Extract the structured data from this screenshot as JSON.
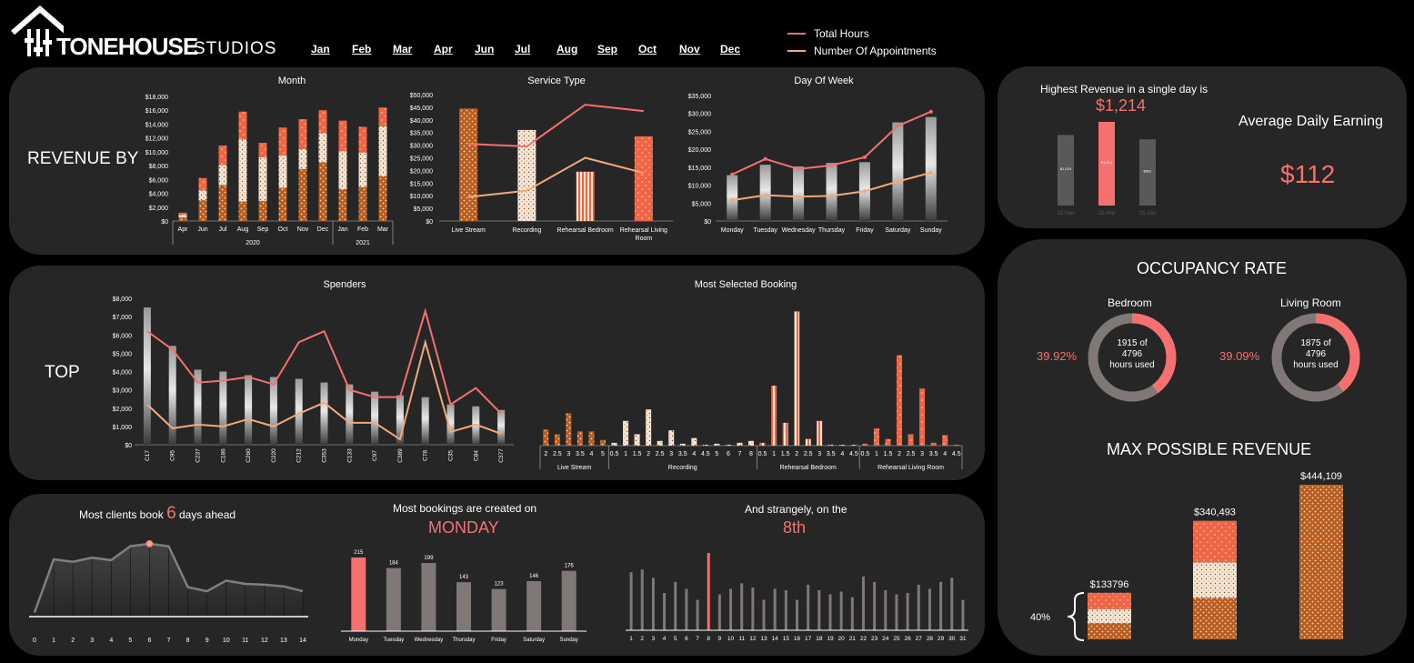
{
  "brand": {
    "name": "TONEHOUSE",
    "suffix": "STUDIOS"
  },
  "months_nav": [
    "Jan",
    "Feb",
    "Mar",
    "Apr",
    "Jun",
    "Jul",
    "Aug",
    "Sep",
    "Oct",
    "Nov",
    "Dec"
  ],
  "legend": {
    "total_hours": "Total Hours",
    "appointments": "Number Of Appointments"
  },
  "colors": {
    "background": "#000000",
    "panel": "#262626",
    "accent": "#f4716f",
    "peach": "#f2a97e",
    "brown": "#b85d1f",
    "orange": "#f06543"
  },
  "revenue": {
    "heading": "REVENUE BY"
  },
  "top": {
    "heading": "TOP"
  },
  "highest": {
    "label": "Highest Revenue in a single day is",
    "value": "$1,214",
    "bars": [
      {
        "date": "11-Mar",
        "label": "$1,024",
        "value": 1024
      },
      {
        "date": "15-Mar",
        "label": "$1,214",
        "value": 1214
      },
      {
        "date": "31-Jan",
        "label": "$961",
        "value": 961
      }
    ]
  },
  "average": {
    "label": "Average Daily Earning",
    "value": "$112"
  },
  "occupancy": {
    "title": "OCCUPANCY RATE",
    "bedroom": {
      "label": "Bedroom",
      "pct": "39.92%",
      "text1": "1915 of",
      "text2": "4796",
      "text3": "hours used",
      "fraction": 0.3992
    },
    "living": {
      "label": "Living Room",
      "pct": "39.09%",
      "text1": "1875 of",
      "text2": "4796",
      "text3": "hours used",
      "fraction": 0.3909
    }
  },
  "max_revenue": {
    "title": "MAX POSSIBLE REVENUE",
    "bars": [
      {
        "label": "$133796",
        "value": 133796
      },
      {
        "label": "$340,493",
        "value": 340493
      },
      {
        "label": "$444,109",
        "value": 444109
      }
    ],
    "pct_label": "40%"
  },
  "clients": {
    "pre": "Most clients book",
    "num": "6",
    "post": "days ahead"
  },
  "bookings_created": {
    "label": "Most bookings are created on",
    "value": "MONDAY"
  },
  "strangely": {
    "label": "And strangely, on the",
    "value": "8th"
  },
  "chart_data": [
    {
      "id": "month",
      "type": "bar",
      "title": "Month",
      "stacked": true,
      "ytick_labels": [
        "$18,000",
        "$16,000",
        "$14,000",
        "$12,000",
        "$10,000",
        "$8,000",
        "$6,000",
        "$4,000",
        "$2,000",
        "$0"
      ],
      "ylim": [
        0,
        18000
      ],
      "categories": [
        "Apr",
        "Jun",
        "Jul",
        "Aug",
        "Sep",
        "Oct",
        "Nov",
        "Dec",
        "Jan",
        "Feb",
        "Mar"
      ],
      "groups": [
        {
          "label": "2020",
          "span": 8
        },
        {
          "label": "2021",
          "span": 3
        }
      ],
      "series": [
        {
          "values": [
            500,
            3000,
            5200,
            2800,
            2900,
            4800,
            7500,
            8500,
            4600,
            4900,
            6500
          ]
        },
        {
          "values": [
            400,
            1400,
            2900,
            9000,
            6300,
            4700,
            2900,
            4200,
            5500,
            5000,
            7200
          ]
        },
        {
          "values": [
            300,
            1800,
            2800,
            4000,
            2100,
            4000,
            4300,
            3300,
            4400,
            3700,
            2700
          ]
        }
      ]
    },
    {
      "id": "service",
      "type": "bar",
      "title": "Service Type",
      "ytick_labels": [
        "$50,000",
        "$45,000",
        "$40,000",
        "$35,000",
        "$30,000",
        "$25,000",
        "$20,000",
        "$15,000",
        "$10,000",
        "$5,000",
        "$0"
      ],
      "ylim": [
        0,
        50000
      ],
      "categories": [
        "Live Stream",
        "Recording",
        "Rehearsal Bedroom",
        "Rehearsal Living Room"
      ],
      "values": [
        44500,
        36000,
        19500,
        33500
      ],
      "lines": [
        {
          "values": [
            30500,
            29500,
            46000,
            43500
          ]
        },
        {
          "values": [
            9500,
            12000,
            25000,
            19000
          ]
        }
      ]
    },
    {
      "id": "dow",
      "type": "bar",
      "title": "Day Of Week",
      "ytick_labels": [
        "$35,000",
        "$30,000",
        "$25,000",
        "$20,000",
        "$15,000",
        "$10,000",
        "$5,000",
        "$0"
      ],
      "ylim": [
        0,
        35000
      ],
      "categories": [
        "Monday",
        "Tuesday",
        "Wednesday",
        "Thursday",
        "Friday",
        "Saturday",
        "Sunday"
      ],
      "values": [
        12800,
        15700,
        15200,
        16200,
        16400,
        27500,
        29000
      ],
      "lines": [
        {
          "values": [
            13000,
            17300,
            14500,
            15500,
            17800,
            26500,
            30500
          ]
        },
        {
          "values": [
            5800,
            7200,
            6800,
            7000,
            8300,
            11000,
            13500
          ]
        }
      ]
    },
    {
      "id": "spenders",
      "type": "bar",
      "title": "Spenders",
      "ytick_labels": [
        "$8,000",
        "$7,000",
        "$6,000",
        "$5,000",
        "$4,000",
        "$3,000",
        "$2,000",
        "$1,000",
        "$0"
      ],
      "ylim": [
        0,
        8000
      ],
      "categories": [
        "C17",
        "C95",
        "C237",
        "C186",
        "C260",
        "C220",
        "C212",
        "C353",
        "C133",
        "C97",
        "C389",
        "C78",
        "C35",
        "C84",
        "C377"
      ],
      "values": [
        7500,
        5400,
        4100,
        4000,
        3800,
        3700,
        3600,
        3400,
        3300,
        2900,
        2700,
        2600,
        2200,
        2100,
        1900
      ],
      "lines": [
        {
          "values": [
            6200,
            5200,
            3400,
            3500,
            3700,
            3300,
            5600,
            6200,
            3000,
            2600,
            2600,
            7300,
            2200,
            3100,
            1700
          ]
        },
        {
          "values": [
            2200,
            900,
            1100,
            1000,
            1400,
            1000,
            1700,
            2300,
            1200,
            1200,
            300,
            5600,
            700,
            1100,
            600
          ]
        }
      ]
    },
    {
      "id": "booking",
      "type": "bar",
      "title": "Most Selected Booking",
      "groups": [
        {
          "label": "Live Stream",
          "cats": [
            "2",
            "2.5",
            "3",
            "3.5",
            "4",
            "5"
          ],
          "values": [
            17,
            12,
            34,
            15,
            15,
            6
          ]
        },
        {
          "label": "Recording",
          "cats": [
            "0.5",
            "1",
            "1.5",
            "2",
            "2.5",
            "3",
            "3.5",
            "4",
            "4.5",
            "5",
            "6",
            "7",
            "8"
          ],
          "values": [
            3,
            26,
            12,
            38,
            5,
            16,
            2,
            8,
            1,
            2,
            1,
            3,
            5
          ]
        },
        {
          "label": "Rehearsal Bedroom",
          "cats": [
            "0.5",
            "1",
            "1.5",
            "2",
            "2.5",
            "3",
            "3.5",
            "4",
            "4.5"
          ],
          "values": [
            3,
            63,
            24,
            141,
            7,
            26,
            1,
            1,
            1
          ]
        },
        {
          "label": "Rehearsal Living Room",
          "cats": [
            "0.5",
            "1",
            "1.5",
            "2",
            "2.5",
            "3",
            "3.5",
            "4",
            "4.5"
          ],
          "values": [
            2,
            18,
            7,
            95,
            12,
            60,
            3,
            11,
            1
          ]
        }
      ]
    },
    {
      "id": "days-ahead",
      "type": "line",
      "categories": [
        "0",
        "1",
        "2",
        "3",
        "4",
        "5",
        "6",
        "7",
        "8",
        "9",
        "10",
        "11",
        "12",
        "13",
        "14"
      ],
      "values": [
        0.05,
        0.7,
        0.67,
        0.72,
        0.69,
        0.86,
        0.89,
        0.86,
        0.36,
        0.31,
        0.44,
        0.4,
        0.39,
        0.37,
        0.31
      ],
      "highlight_index": 6
    },
    {
      "id": "created-on",
      "type": "bar",
      "categories": [
        "Monday",
        "Tuesday",
        "Wednesday",
        "Thursday",
        "Friday",
        "Saturday",
        "Sunday"
      ],
      "values": [
        215,
        184,
        199,
        143,
        123,
        146,
        176
      ],
      "highlight_index": 0
    },
    {
      "id": "day-of-month",
      "type": "bar",
      "categories": [
        "1",
        "2",
        "3",
        "4",
        "5",
        "6",
        "7",
        "8",
        "9",
        "10",
        "11",
        "12",
        "13",
        "14",
        "15",
        "16",
        "17",
        "18",
        "19",
        "20",
        "21",
        "22",
        "23",
        "24",
        "25",
        "26",
        "27",
        "28",
        "29",
        "30",
        "31"
      ],
      "values": [
        42,
        44,
        38,
        27,
        35,
        30,
        22,
        56,
        26,
        30,
        34,
        31,
        22,
        30,
        29,
        22,
        33,
        29,
        26,
        28,
        24,
        39,
        35,
        29,
        26,
        27,
        33,
        30,
        35,
        38,
        22
      ],
      "highlight_index": 7
    }
  ]
}
